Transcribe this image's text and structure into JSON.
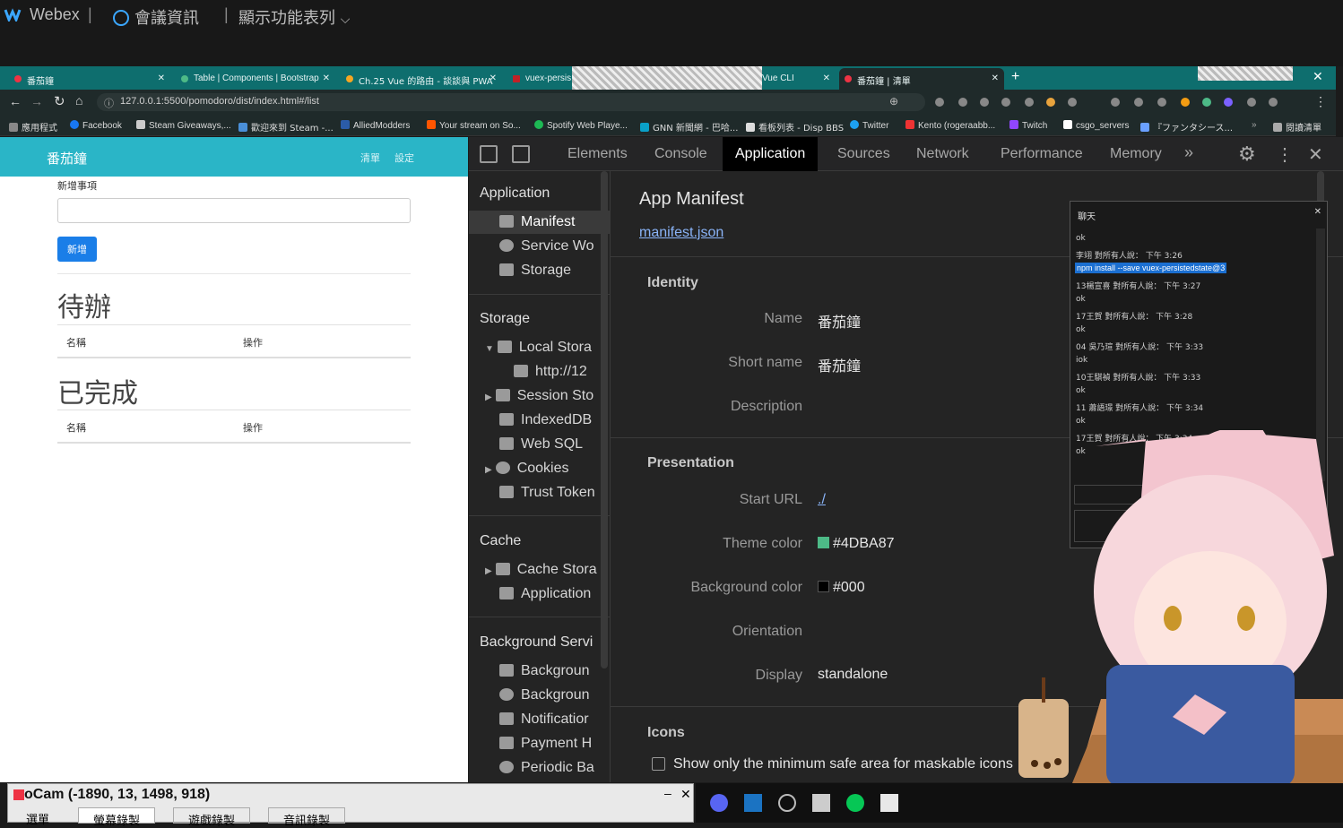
{
  "webex": {
    "logo_text": "Webex",
    "meeting_info": "會議資訊",
    "show_menu": "顯示功能表列"
  },
  "tabs": [
    {
      "title": "番茄鐘"
    },
    {
      "title": "Table | Components | Bootstrap"
    },
    {
      "title": "Ch.25 Vue 的路由 - 談談與 PWA"
    },
    {
      "title": "vuex-persis"
    },
    {
      "title": "Vue CLI"
    },
    {
      "title": "番茄鐘 | 清單"
    }
  ],
  "new_tab_label": "+",
  "address": {
    "url": "127.0.0.1:5500/pomodoro/dist/index.html#/list"
  },
  "bookmarks": [
    {
      "label": "應用程式",
      "color": "#888888"
    },
    {
      "label": "Facebook",
      "color": "#1877f2"
    },
    {
      "label": "Steam Giveaways,...",
      "color": "#cccccc"
    },
    {
      "label": "歡迎來到 Steam -...",
      "color": "#4a8fd8"
    },
    {
      "label": "AlliedModders",
      "color": "#2b5ca8"
    },
    {
      "label": "Your stream on So...",
      "color": "#ff5500"
    },
    {
      "label": "Spotify Web Playe...",
      "color": "#1db954"
    },
    {
      "label": "GNN 新聞網 - 巴哈...",
      "color": "#0aa0c8"
    },
    {
      "label": "看板列表 - Disp BBS",
      "color": "#dddddd"
    },
    {
      "label": "Twitter",
      "color": "#1da1f2"
    },
    {
      "label": "Kento (rogeraabb...",
      "color": "#e33"
    },
    {
      "label": "Twitch",
      "color": "#9146ff"
    },
    {
      "label": "csgo_servers",
      "color": "#ffffff"
    },
    {
      "label": "『ファンタシース...",
      "color": "#6aa0ff"
    },
    {
      "label": "閱讀清單",
      "color": "#aaaaaa"
    }
  ],
  "app": {
    "brand": "番茄鐘",
    "nav_list": "清單",
    "nav_settings": "設定",
    "new_todo_label": "新增事項",
    "new_todo_value": "",
    "add_button": "新增",
    "todo_heading": "待辦",
    "done_heading": "已完成",
    "col_name": "名稱",
    "col_action": "操作"
  },
  "devtools": {
    "tabs": [
      "Elements",
      "Console",
      "Application",
      "Sources",
      "Network",
      "Performance",
      "Memory",
      "»"
    ],
    "active_tab": "Application",
    "sidebar": {
      "application_header": "Application",
      "application_items": [
        "Manifest",
        "Service Wo",
        "Storage"
      ],
      "storage_header": "Storage",
      "storage_items": [
        "Local Stora",
        "http://12",
        "Session Sto",
        "IndexedDB",
        "Web SQL",
        "Cookies",
        "Trust Token"
      ],
      "cache_header": "Cache",
      "cache_items": [
        "Cache Stora",
        "Application"
      ],
      "bg_header": "Background Servi",
      "bg_items": [
        "Backgroun",
        "Backgroun",
        "Notificatior",
        "Payment H",
        "Periodic Ba"
      ]
    },
    "manifest": {
      "title": "App Manifest",
      "link": "manifest.json",
      "identity_header": "Identity",
      "name_label": "Name",
      "name_value": "番茄鐘",
      "short_name_label": "Short name",
      "short_name_value": "番茄鐘",
      "description_label": "Description",
      "presentation_header": "Presentation",
      "start_url_label": "Start URL",
      "start_url_value": "./",
      "theme_color_label": "Theme color",
      "theme_color_value": "#4DBA87",
      "bg_color_label": "Background color",
      "bg_color_value": "#000",
      "orientation_label": "Orientation",
      "display_label": "Display",
      "display_value": "standalone",
      "icons_header": "Icons",
      "mask_checkbox_label": "Show only the minimum safe area for maskable icons"
    }
  },
  "chat": {
    "title": "聊天",
    "lines": [
      {
        "text": "ok",
        "highlight": false
      },
      {
        "text": "李翊 對所有人說：  下午 3:26",
        "highlight": false
      },
      {
        "text": "npm install --save vuex-persistedstate@3",
        "highlight": true
      },
      {
        "text": "13楊宣喜 對所有人說：  下午 3:27",
        "highlight": false
      },
      {
        "text": "ok",
        "highlight": false
      },
      {
        "text": "17王賀 對所有人說：  下午 3:28",
        "highlight": false
      },
      {
        "text": "ok",
        "highlight": false
      },
      {
        "text": "04 吳乃瑄 對所有人說：  下午 3:33",
        "highlight": false
      },
      {
        "text": "iok",
        "highlight": false
      },
      {
        "text": "10王騏禎 對所有人說：  下午 3:33",
        "highlight": false
      },
      {
        "text": "ok",
        "highlight": false
      },
      {
        "text": "11 蕭語璟 對所有人說：  下午 3:34",
        "highlight": false
      },
      {
        "text": "ok",
        "highlight": false
      },
      {
        "text": "17王賀 對所有人說：  下午 3:34",
        "highlight": false
      },
      {
        "text": "ok",
        "highlight": false
      }
    ]
  },
  "ocam": {
    "title": "oCam (-1890, 13, 1498, 918)",
    "tabs": [
      "選單",
      "螢幕錄製",
      "遊戲錄製",
      "音訊錄製"
    ]
  }
}
